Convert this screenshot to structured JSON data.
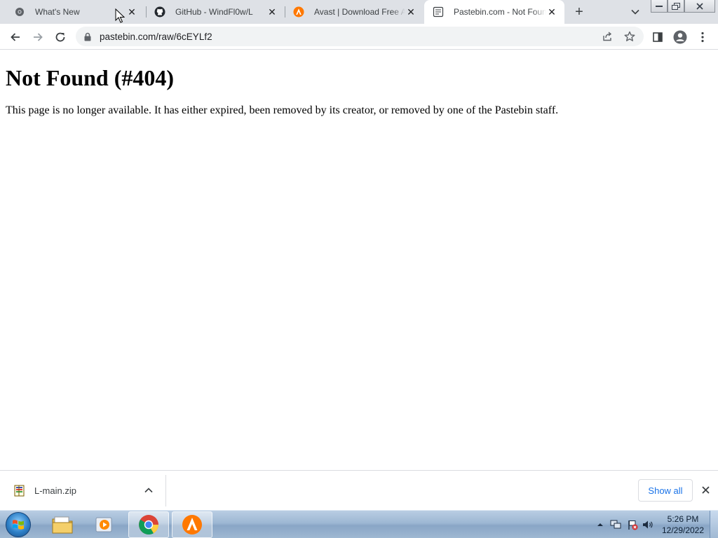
{
  "browser": {
    "tabs": [
      {
        "title": "What's New",
        "favicon": "chrome-settings-icon",
        "active": false
      },
      {
        "title": "GitHub - WindFl0w/L",
        "favicon": "github-icon",
        "active": false
      },
      {
        "title": "Avast | Download Free Antivirus",
        "favicon": "avast-icon",
        "active": false
      },
      {
        "title": "Pastebin.com - Not Found",
        "favicon": "pastebin-icon",
        "active": true
      }
    ],
    "new_tab_label": "+",
    "url": "pastebin.com/raw/6cEYLf2"
  },
  "page": {
    "heading": "Not Found (#404)",
    "message": "This page is no longer available. It has either expired, been removed by its creator, or removed by one of the Pastebin staff."
  },
  "downloads": {
    "file_name": "L-main.zip",
    "show_all_label": "Show all"
  },
  "taskbar": {
    "time": "5:26 PM",
    "date": "12/29/2022"
  },
  "colors": {
    "tabstrip": "#dee1e6",
    "accent_link": "#1a73e8",
    "avast_orange": "#ff7800"
  }
}
